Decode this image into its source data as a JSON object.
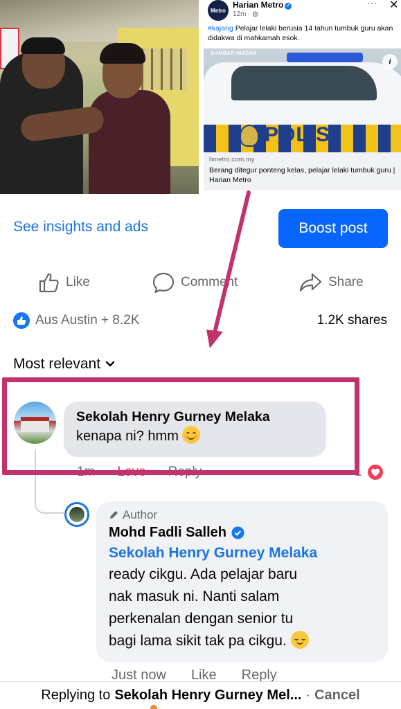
{
  "shared_post": {
    "page_name": "Harian Metro",
    "page_avatar_text": "Metro",
    "time": "12m",
    "hashtag": "#kajang",
    "caption": " Pelajar lelaki berusia 14 tahun tumbuk guru akan didakwa di mahkamah esok.",
    "image_label": "GAMBAR HIASAN",
    "image_text": "POLIS",
    "link_domain": "hmetro.com.my",
    "link_title": "Berang ditegur ponteng kelas, pelajar lelaki tumbuk guru | Harian Metro"
  },
  "insights_link": "See insights and ads",
  "boost_button": "Boost post",
  "actions": {
    "like": "Like",
    "comment": "Comment",
    "share": "Share"
  },
  "reactions_summary": "Aus Austin + 8.2K",
  "shares_count": "1.2K shares",
  "sort_label": "Most relevant",
  "comment": {
    "author": "Sekolah Henry Gurney Melaka",
    "text": "kenapa ni? hmm",
    "time": "1m",
    "love_label": "Love",
    "reply_label": "Reply",
    "reaction_count": "1"
  },
  "reply": {
    "badge": "Author",
    "author": "Mohd Fadli Salleh",
    "mention": "Sekolah Henry Gurney Melaka",
    "lines": [
      "ready cikgu. Ada pelajar baru",
      "nak masuk ni. Nanti salam",
      "perkenalan dengan senior tu",
      "bagi lama sikit tak pa cikgu."
    ],
    "time": "Just now",
    "like_label": "Like",
    "reply_label": "Reply"
  },
  "reply_bar": {
    "prefix": "Replying to",
    "target": "Sekolah Henry Gurney Mel...",
    "separator": "·",
    "cancel": "Cancel"
  },
  "colors": {
    "accent": "#1b74e4",
    "boost": "#0866ff",
    "love": "#e41e3f",
    "highlight": "#c2336d"
  }
}
